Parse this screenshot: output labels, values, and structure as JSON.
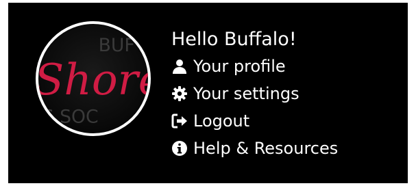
{
  "greeting": "Hello Buffalo!",
  "avatar": {
    "logo_text_script": "Shore",
    "logo_text_top": "BUF",
    "logo_text_bottom": "S SOC",
    "accent_color": "#d01c44"
  },
  "menu": {
    "items": [
      {
        "label": "Your profile",
        "icon": "user-icon"
      },
      {
        "label": "Your settings",
        "icon": "gear-icon"
      },
      {
        "label": "Logout",
        "icon": "logout-icon"
      },
      {
        "label": "Help & Resources",
        "icon": "info-icon"
      }
    ]
  },
  "colors": {
    "panel_bg": "#000000",
    "text": "#ffffff"
  }
}
